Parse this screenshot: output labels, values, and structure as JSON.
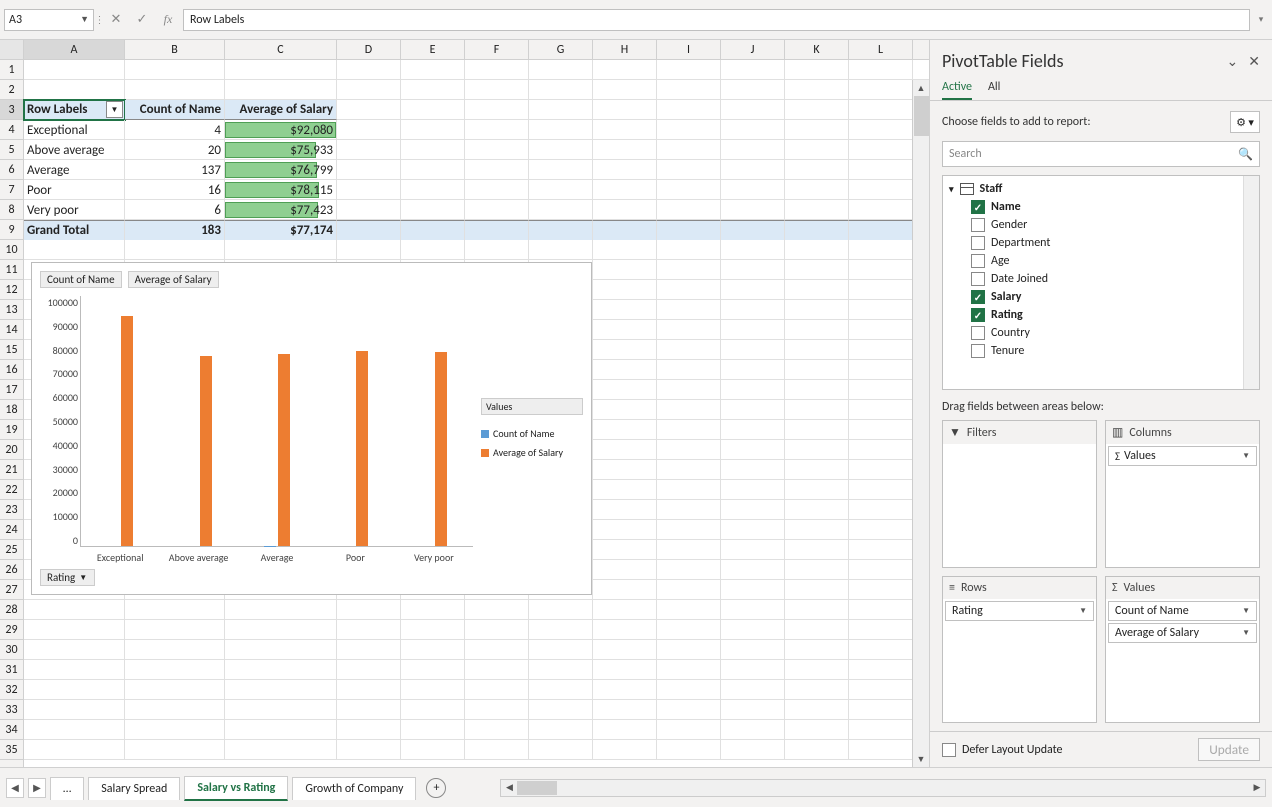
{
  "name_box": "A3",
  "formula_bar": "Row Labels",
  "columns": [
    "A",
    "B",
    "C",
    "D",
    "E",
    "F",
    "G",
    "H",
    "I",
    "J",
    "K",
    "L"
  ],
  "row_count": 35,
  "pivot": {
    "headers": {
      "row_labels": "Row Labels",
      "count": "Count of Name",
      "avg": "Average of Salary"
    },
    "rows": [
      {
        "label": "Exceptional",
        "count": "4",
        "avg": "$92,080",
        "bar_pct": 100
      },
      {
        "label": "Above average",
        "count": "20",
        "avg": "$75,933",
        "bar_pct": 82
      },
      {
        "label": "Average",
        "count": "137",
        "avg": "$76,799",
        "bar_pct": 83
      },
      {
        "label": "Poor",
        "count": "16",
        "avg": "$78,115",
        "bar_pct": 85
      },
      {
        "label": "Very poor",
        "count": "6",
        "avg": "$77,423",
        "bar_pct": 84
      }
    ],
    "total": {
      "label": "Grand Total",
      "count": "183",
      "avg": "$77,174"
    }
  },
  "chart": {
    "btn_count": "Count of Name",
    "btn_avg": "Average of Salary",
    "rating": "Rating",
    "legend_title": "Values",
    "legend1": "Count of Name",
    "legend2": "Average of Salary",
    "y_ticks": [
      "100000",
      "90000",
      "80000",
      "70000",
      "60000",
      "50000",
      "40000",
      "30000",
      "20000",
      "10000",
      "0"
    ]
  },
  "chart_data": {
    "type": "bar",
    "categories": [
      "Exceptional",
      "Above average",
      "Average",
      "Poor",
      "Very poor"
    ],
    "series": [
      {
        "name": "Count of Name",
        "values": [
          4,
          20,
          137,
          16,
          6
        ]
      },
      {
        "name": "Average of Salary",
        "values": [
          92080,
          75933,
          76799,
          78115,
          77423
        ]
      }
    ],
    "ylim": [
      0,
      100000
    ],
    "xlabel": "",
    "ylabel": "",
    "title": ""
  },
  "panel": {
    "title": "PivotTable Fields",
    "tab_active": "Active",
    "tab_all": "All",
    "choose": "Choose fields to add to report:",
    "search_placeholder": "Search",
    "table_name": "Staff",
    "fields": [
      {
        "name": "Name",
        "on": true
      },
      {
        "name": "Gender",
        "on": false
      },
      {
        "name": "Department",
        "on": false
      },
      {
        "name": "Age",
        "on": false
      },
      {
        "name": "Date Joined",
        "on": false
      },
      {
        "name": "Salary",
        "on": true
      },
      {
        "name": "Rating",
        "on": true
      },
      {
        "name": "Country",
        "on": false
      },
      {
        "name": "Tenure",
        "on": false
      }
    ],
    "drag_label": "Drag fields between areas below:",
    "area_filters": "Filters",
    "area_columns": "Columns",
    "area_rows": "Rows",
    "area_values": "Values",
    "col_pill_values": "Values",
    "row_pill": "Rating",
    "val_pill1": "Count of Name",
    "val_pill2": "Average of Salary",
    "defer": "Defer Layout Update",
    "update": "Update"
  },
  "tabs": {
    "ellipsis": "…",
    "t1": "Salary Spread",
    "t2": "Salary vs Rating",
    "t3": "Growth of Company"
  }
}
